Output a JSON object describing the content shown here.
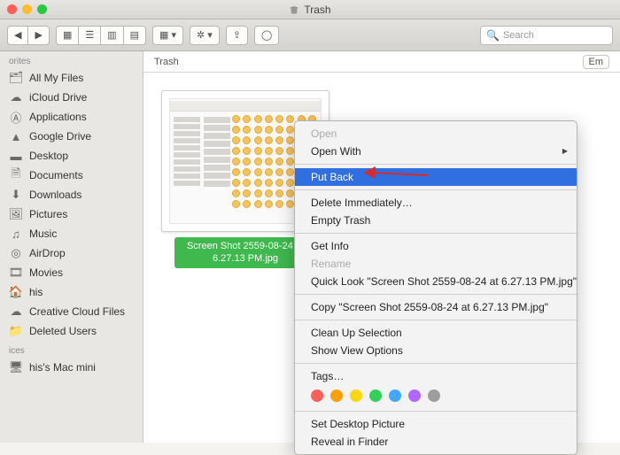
{
  "window": {
    "title": "Trash"
  },
  "toolbar": {
    "search_placeholder": "Search",
    "empty_label": "Em"
  },
  "sidebar": {
    "sections": [
      {
        "label": "orites",
        "items": [
          {
            "icon": "all-my-files",
            "label": "All My Files"
          },
          {
            "icon": "icloud",
            "label": "iCloud Drive"
          },
          {
            "icon": "applications",
            "label": "Applications"
          },
          {
            "icon": "google-drive",
            "label": "Google Drive"
          },
          {
            "icon": "desktop",
            "label": "Desktop"
          },
          {
            "icon": "documents",
            "label": "Documents"
          },
          {
            "icon": "downloads",
            "label": "Downloads"
          },
          {
            "icon": "pictures",
            "label": "Pictures"
          },
          {
            "icon": "music",
            "label": "Music"
          },
          {
            "icon": "airdrop",
            "label": "AirDrop"
          },
          {
            "icon": "movies",
            "label": "Movies"
          },
          {
            "icon": "home",
            "label": "his"
          },
          {
            "icon": "creative-cloud",
            "label": "Creative Cloud Files"
          },
          {
            "icon": "folder",
            "label": "Deleted Users"
          }
        ]
      },
      {
        "label": "ices",
        "items": [
          {
            "icon": "mac-mini",
            "label": "his's Mac mini"
          }
        ]
      }
    ]
  },
  "main": {
    "header": "Trash",
    "selected_file": "Screen Shot 2559-08-24 at 6.27.13 PM.jpg",
    "selected_file_wrapped": "Screen Shot 2559-08-24 at 6.27.13 PM.jpg"
  },
  "context_menu": {
    "open": "Open",
    "open_with": "Open With",
    "put_back": "Put Back",
    "delete_immediately": "Delete Immediately…",
    "empty_trash": "Empty Trash",
    "get_info": "Get Info",
    "rename": "Rename",
    "quick_look": "Quick Look \"Screen Shot 2559-08-24 at 6.27.13 PM.jpg\"",
    "copy": "Copy \"Screen Shot 2559-08-24 at 6.27.13 PM.jpg\"",
    "clean_up": "Clean Up Selection",
    "show_view_options": "Show View Options",
    "tags": "Tags…",
    "set_desktop": "Set Desktop Picture",
    "reveal": "Reveal in Finder",
    "tag_colors": [
      "#ff5f57",
      "#ff9f0a",
      "#ffd60a",
      "#30d158",
      "#42a7ff",
      "#b266ff",
      "#9e9e9e"
    ]
  }
}
